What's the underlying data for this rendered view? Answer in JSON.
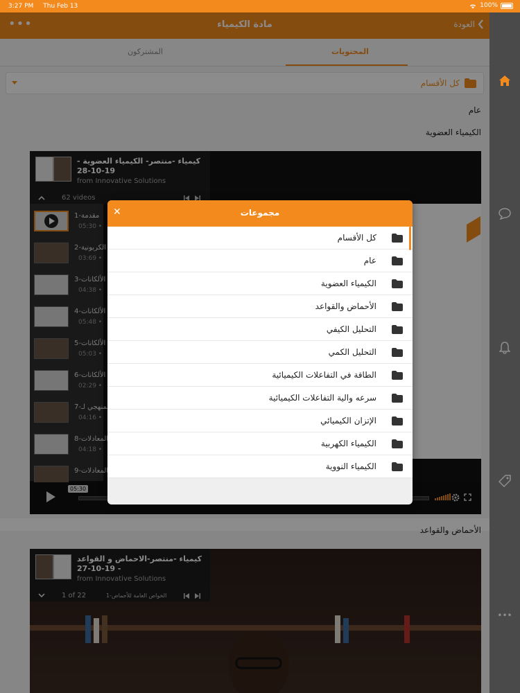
{
  "status_bar": {
    "time": "3:27 PM",
    "date": "Thu Feb 13",
    "battery": "100%"
  },
  "nav": {
    "title": "مادة الكيمياء",
    "back_label": "العودة",
    "more_icon": "ellipsis-icon"
  },
  "tabs": [
    {
      "label": "المحتويات",
      "active": true
    },
    {
      "label": "المشتركون",
      "active": false
    }
  ],
  "filter": {
    "label": "كل الأقسام"
  },
  "sections": {
    "general": "عام",
    "organic": "الكيمياء العضوية",
    "acids": "الأحماض والقواعد"
  },
  "video1": {
    "title": "كيمياء -منتصر- الكيمياء العضوية - 19-10-28",
    "from": "from Innovative Solutions",
    "count": "62 videos",
    "tooltip_time": "05:30",
    "playlist": [
      {
        "title": "مقدمة-1",
        "time": "05:30 •"
      },
      {
        "title": "الكربونية-2",
        "time": "03:69 •"
      },
      {
        "title": "الألكانات-3",
        "time": "04:38 •"
      },
      {
        "title": "الألكانات-4",
        "time": "05:48 •"
      },
      {
        "title": "الألكانات-5",
        "time": "05:03 •"
      },
      {
        "title": "الألكانات-6",
        "time": "02:29 •"
      },
      {
        "title": "المنهجي لـ-7",
        "time": "04:16 •"
      },
      {
        "title": "المعادلات-8",
        "time": "04:18 •"
      },
      {
        "title": "المعادلات-9",
        "time": ""
      }
    ]
  },
  "video2": {
    "title": "كيمياء -منتصر-الاحماض و القواعد - 19-10-27",
    "from": "from Innovative Solutions",
    "counter": "1 of 22",
    "current": "الخواص العامة للأحماض-1"
  },
  "modal": {
    "title": "مجموعات",
    "items": [
      "كل الأقسام",
      "عام",
      "الكيمياء العضوية",
      "الأحماض والقواعد",
      "التحليل الكيفي",
      "التحليل الكمي",
      "الطاقة في التفاعلات الكيميائية",
      "سرعه والية التفاعلات الكيميائية",
      "الإتزان الكيميائي",
      "الكيمياء الكهربية",
      "الكيمياء النووية"
    ]
  },
  "colors": {
    "accent": "#f28a1e",
    "sidebar": "#4a4a4a"
  }
}
